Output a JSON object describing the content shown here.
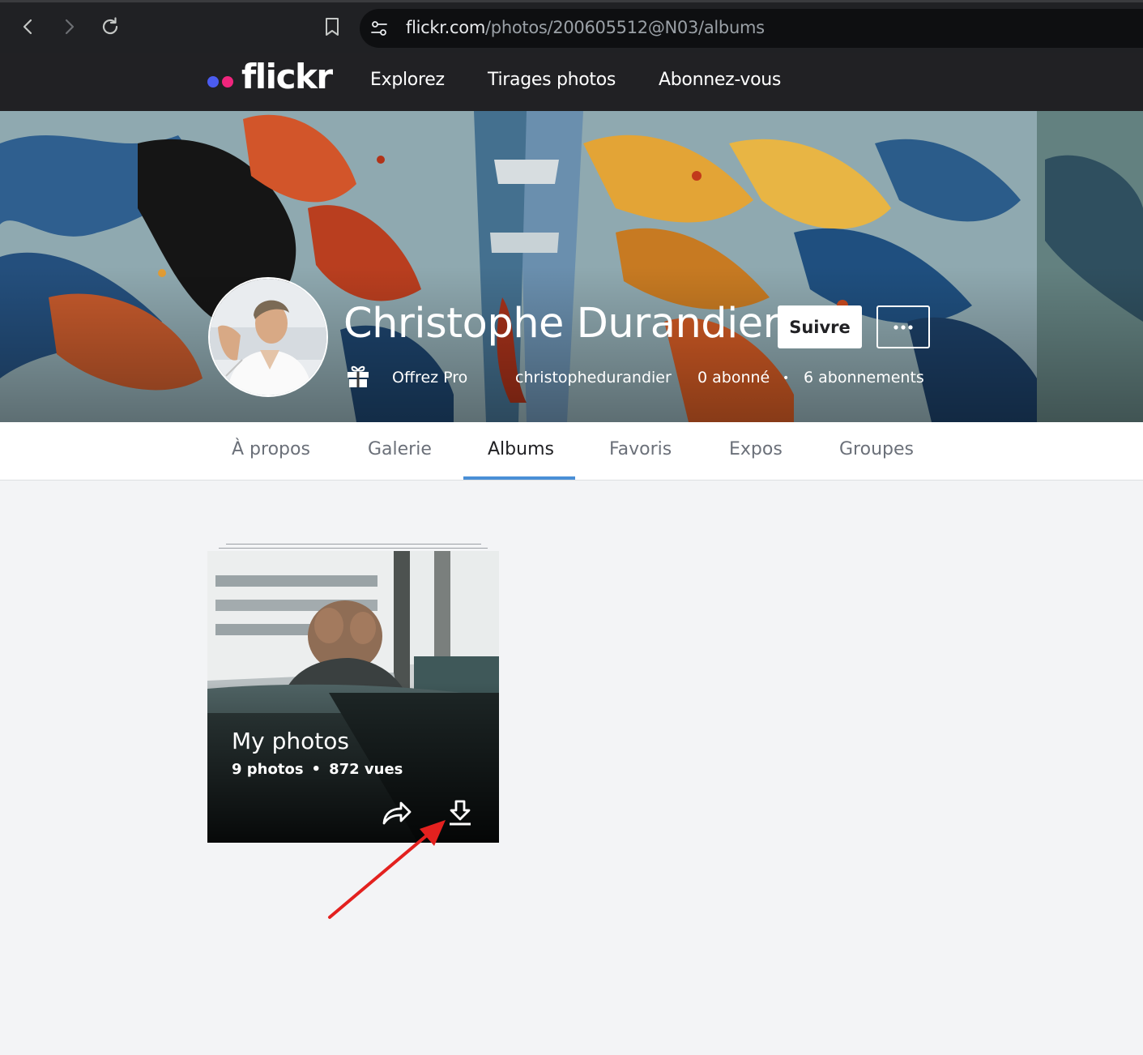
{
  "browser": {
    "url_host": "flickr.com",
    "url_path": "/photos/200605512@N03/albums"
  },
  "header": {
    "logo_text": "flickr",
    "logo_colors": [
      "#4b5cf0",
      "#f0257d"
    ],
    "nav": [
      "Explorez",
      "Tirages photos",
      "Abonnez-vous"
    ]
  },
  "profile": {
    "name": "Christophe Durandier",
    "follow_label": "Suivre",
    "gift_label": "Offrez Pro",
    "username": "christophedurandier",
    "followers": "0 abonné",
    "following": "6 abonnements",
    "separator": "•"
  },
  "tabs": {
    "items": [
      "À propos",
      "Galerie",
      "Albums",
      "Favoris",
      "Expos",
      "Groupes"
    ],
    "active": "Albums",
    "accent_color": "#4a8fd6"
  },
  "album": {
    "title": "My photos",
    "photos": "9 photos",
    "views": "872 vues",
    "separator": "•",
    "actions": [
      "share-icon",
      "download-icon"
    ]
  },
  "annotation": {
    "color": "#e3211f",
    "target": "download-icon"
  }
}
